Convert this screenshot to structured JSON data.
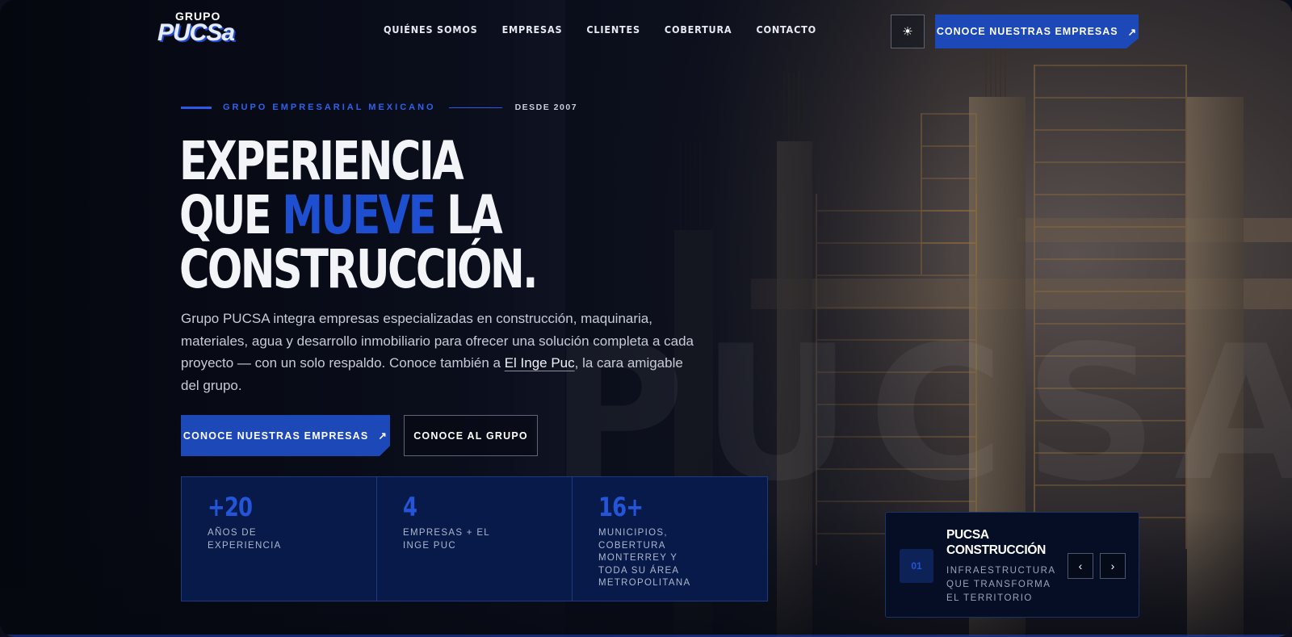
{
  "header": {
    "logo_top": "GRUPO",
    "logo_main": "PUCSa",
    "nav": [
      "QUIÉNES SOMOS",
      "EMPRESAS",
      "CLIENTES",
      "COBERTURA",
      "CONTACTO"
    ],
    "theme_icon": "☀",
    "cta": "CONOCE NUESTRAS EMPRESAS",
    "cta_arrow": "↗"
  },
  "hero": {
    "eyebrow": "GRUPO EMPRESARIAL MEXICANO",
    "since": "DESDE 2007",
    "headline_line1": "EXPERIENCIA",
    "headline_que": "QUE",
    "headline_highlight": "MUEVE",
    "headline_la": "LA",
    "headline_line3": "CONSTRUCCIÓN.",
    "desc_before": "Grupo PUCSA integra empresas especializadas en construcción, maquinaria, materiales, agua y desarrollo inmobiliario para ofrecer una solución completa a cada proyecto — con un solo respaldo. Conoce también a ",
    "desc_link": "El Inge Puc",
    "desc_after": ", la cara amigable del grupo.",
    "btn_primary": "CONOCE NUESTRAS EMPRESAS",
    "btn_primary_arrow": "↗",
    "btn_secondary": "CONOCE AL GRUPO",
    "ghost": "PUCSA"
  },
  "stats": [
    {
      "num": "+20",
      "label": "AÑOS DE EXPERIENCIA"
    },
    {
      "num": "4",
      "label": "EMPRESAS + EL INGE PUC"
    },
    {
      "num": "16+",
      "label": "MUNICIPIOS, COBERTURA MONTERREY Y TODA SU ÁREA METROPOLITANA"
    }
  ],
  "card": {
    "index": "01",
    "title": "PUCSA CONSTRUCCIÓN",
    "subtitle": "INFRAESTRUCTURA QUE TRANSFORMA EL TERRITORIO",
    "prev": "‹",
    "next": "›"
  },
  "colors": {
    "accent": "#1d49b8",
    "highlight": "#1f4fd1",
    "stat_bg": "#071a4a"
  }
}
